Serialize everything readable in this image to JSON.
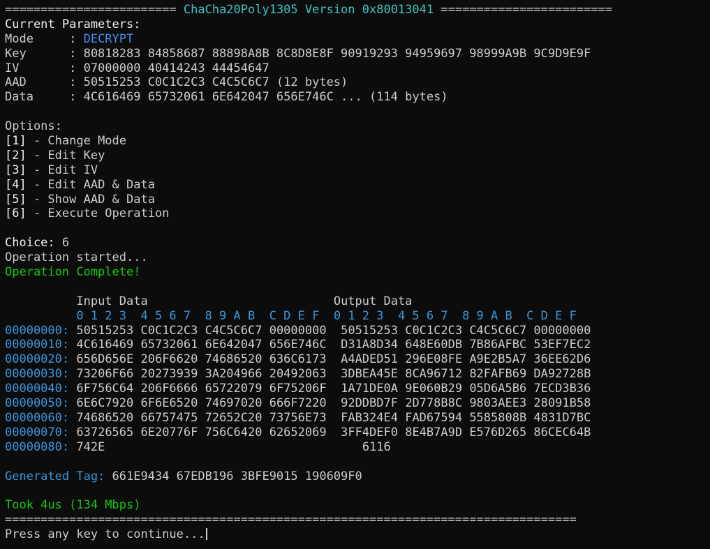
{
  "header": {
    "left_rule": "========================",
    "title": "ChaCha20Poly1305 Version 0x80013041",
    "right_rule": "========================"
  },
  "params": {
    "heading": "Current Parameters:",
    "mode_label": "Mode     : ",
    "mode_value": "DECRYPT",
    "key_line": "Key      : 80818283 84858687 88898A8B 8C8D8E8F 90919293 94959697 98999A9B 9C9D9E9F",
    "iv_line": "IV       : 07000000 40414243 44454647",
    "aad_line": "AAD      : 50515253 C0C1C2C3 C4C5C6C7 (12 bytes)",
    "data_line": "Data     : 4C616469 65732061 6E642047 656E746C ... (114 bytes)"
  },
  "options": {
    "heading": "Options:",
    "items": [
      {
        "key": "[1]",
        "label": " - Change Mode"
      },
      {
        "key": "[2]",
        "label": " - Edit Key"
      },
      {
        "key": "[3]",
        "label": " - Edit IV"
      },
      {
        "key": "[4]",
        "label": " - Edit AAD & Data"
      },
      {
        "key": "[5]",
        "label": " - Show AAD & Data"
      },
      {
        "key": "[6]",
        "label": " - Execute Operation"
      }
    ]
  },
  "run": {
    "choice_label": "Choice: ",
    "choice_value": "6",
    "started": "Operation started...",
    "complete": "Operation Complete!"
  },
  "dump": {
    "input_title": "Input Data",
    "output_title": "Output Data",
    "col_header": "0 1 2 3  4 5 6 7  8 9 A B  C D E F",
    "rows": [
      {
        "offset": "00000000:",
        "input": "50515253 C0C1C2C3 C4C5C6C7 00000000",
        "output": "50515253 C0C1C2C3 C4C5C6C7 00000000"
      },
      {
        "offset": "00000010:",
        "input": "4C616469 65732061 6E642047 656E746C",
        "output": "D31A8D34 648E60DB 7B86AFBC 53EF7EC2"
      },
      {
        "offset": "00000020:",
        "input": "656D656E 206F6620 74686520 636C6173",
        "output": "A4ADED51 296E08FE A9E2B5A7 36EE62D6"
      },
      {
        "offset": "00000030:",
        "input": "73206F66 20273939 3A204966 20492063",
        "output": "3DBEA45E 8CA96712 82FAFB69 DA92728B"
      },
      {
        "offset": "00000040:",
        "input": "6F756C64 206F6666 65722079 6F75206F",
        "output": "1A71DE0A 9E060B29 05D6A5B6 7ECD3B36"
      },
      {
        "offset": "00000050:",
        "input": "6E6C7920 6F6E6520 74697020 666F7220",
        "output": "92DDBD7F 2D778B8C 9803AEE3 28091B58"
      },
      {
        "offset": "00000060:",
        "input": "74686520 66757475 72652C20 73756E73",
        "output": "FAB324E4 FAD67594 5585808B 4831D7BC"
      },
      {
        "offset": "00000070:",
        "input": "63726565 6E20776F 756C6420 62652069",
        "output": "3FF4DEF0 8E4B7A9D E576D265 86CEC64B"
      },
      {
        "offset": "00000080:",
        "input": "742E",
        "output": "6116"
      }
    ]
  },
  "tag": {
    "label": "Generated Tag: ",
    "value": "661E9434 67EDB196 3BFE9015 190609F0"
  },
  "timing": "Took 4us (134 Mbps)",
  "footer_rule": "================================================================================",
  "prompt": "Press any key to continue...",
  "colors": {
    "background": "#0c0c0c",
    "text": "#cccccc",
    "title": "#3fc3c8",
    "mode_value": "#4a8cf0",
    "hex_labels": "#3a96dd",
    "success": "#16c60c"
  }
}
